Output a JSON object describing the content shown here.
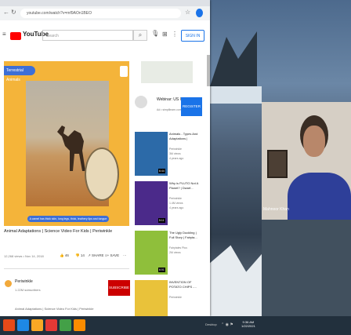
{
  "browser": {
    "url": "youtube.com/watch?v=mf9AOn1BEO",
    "header": {
      "logo_text": "YouTube",
      "search_placeholder": "Search",
      "signin_label": "SIGN IN"
    },
    "video": {
      "chip_label": "Terrestrial Animals",
      "caption": "A camel has thick skin, long legs, thick, leathery lips and tongue",
      "title": "Animal Adaptations | Science Video For Kids | Periwinkle",
      "meta": "12,268 views • Nov 14, 2018",
      "likes": "46",
      "dislikes": "14",
      "share_label": "SHARE",
      "save_label": "SAVE"
    },
    "channel": {
      "name": "Periwinkle",
      "subs": "1.22M subscribers",
      "subscribe_label": "SUBSCRIBE",
      "description": "Animal Adaptations | Science Video For Kids | Periwinkle"
    },
    "ad": {
      "title": "Webinar: US CPA",
      "subtitle": "Ad • simplilearn.com",
      "register_label": "REGISTER"
    },
    "recommendations": [
      {
        "title": "Animals - Types And Adaptations |",
        "channel": "Periwinkle",
        "views": "3M views",
        "age": "4 years ago",
        "duration": "6:44",
        "color": "#2c6aa8"
      },
      {
        "title": "Why is PLUTO Not A Planet? | Dwarf...",
        "channel": "Periwinkle",
        "views": "1.4M views",
        "age": "4 years ago",
        "duration": "5:11",
        "color": "#4b2a8a"
      },
      {
        "title": "The Ugly Duckling | Full Story | Fairyta...",
        "channel": "Fairytales Plus",
        "views": "2M views",
        "age": "",
        "duration": "6:01",
        "color": "#8fbf3b"
      },
      {
        "title": "INVENTION OF POTATO CHIPS -...",
        "channel": "Periwinkle",
        "views": "",
        "age": "",
        "duration": "",
        "color": "#e9c23a"
      }
    ]
  },
  "webcam": {
    "name_label": "Mahnoor Khan"
  },
  "taskbar": {
    "tray_text": "Desktop",
    "time": "9:36 AM",
    "date": "1/22/2021"
  }
}
